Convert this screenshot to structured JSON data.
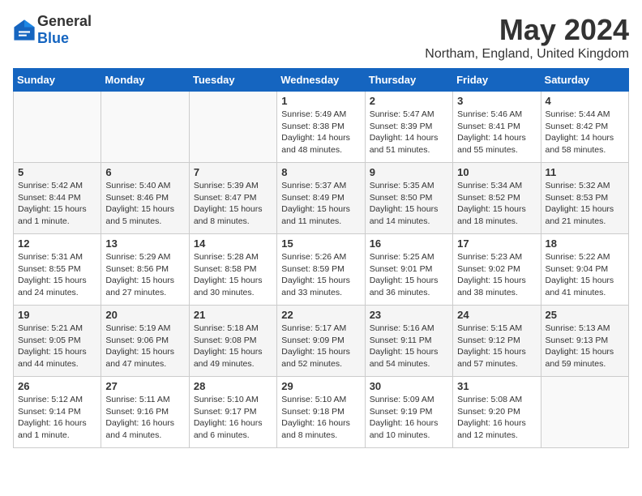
{
  "header": {
    "logo_general": "General",
    "logo_blue": "Blue",
    "month_year": "May 2024",
    "location": "Northam, England, United Kingdom"
  },
  "days_of_week": [
    "Sunday",
    "Monday",
    "Tuesday",
    "Wednesday",
    "Thursday",
    "Friday",
    "Saturday"
  ],
  "weeks": [
    [
      {
        "day": null,
        "info": null
      },
      {
        "day": null,
        "info": null
      },
      {
        "day": null,
        "info": null
      },
      {
        "day": "1",
        "info": "Sunrise: 5:49 AM\nSunset: 8:38 PM\nDaylight: 14 hours\nand 48 minutes."
      },
      {
        "day": "2",
        "info": "Sunrise: 5:47 AM\nSunset: 8:39 PM\nDaylight: 14 hours\nand 51 minutes."
      },
      {
        "day": "3",
        "info": "Sunrise: 5:46 AM\nSunset: 8:41 PM\nDaylight: 14 hours\nand 55 minutes."
      },
      {
        "day": "4",
        "info": "Sunrise: 5:44 AM\nSunset: 8:42 PM\nDaylight: 14 hours\nand 58 minutes."
      }
    ],
    [
      {
        "day": "5",
        "info": "Sunrise: 5:42 AM\nSunset: 8:44 PM\nDaylight: 15 hours\nand 1 minute."
      },
      {
        "day": "6",
        "info": "Sunrise: 5:40 AM\nSunset: 8:46 PM\nDaylight: 15 hours\nand 5 minutes."
      },
      {
        "day": "7",
        "info": "Sunrise: 5:39 AM\nSunset: 8:47 PM\nDaylight: 15 hours\nand 8 minutes."
      },
      {
        "day": "8",
        "info": "Sunrise: 5:37 AM\nSunset: 8:49 PM\nDaylight: 15 hours\nand 11 minutes."
      },
      {
        "day": "9",
        "info": "Sunrise: 5:35 AM\nSunset: 8:50 PM\nDaylight: 15 hours\nand 14 minutes."
      },
      {
        "day": "10",
        "info": "Sunrise: 5:34 AM\nSunset: 8:52 PM\nDaylight: 15 hours\nand 18 minutes."
      },
      {
        "day": "11",
        "info": "Sunrise: 5:32 AM\nSunset: 8:53 PM\nDaylight: 15 hours\nand 21 minutes."
      }
    ],
    [
      {
        "day": "12",
        "info": "Sunrise: 5:31 AM\nSunset: 8:55 PM\nDaylight: 15 hours\nand 24 minutes."
      },
      {
        "day": "13",
        "info": "Sunrise: 5:29 AM\nSunset: 8:56 PM\nDaylight: 15 hours\nand 27 minutes."
      },
      {
        "day": "14",
        "info": "Sunrise: 5:28 AM\nSunset: 8:58 PM\nDaylight: 15 hours\nand 30 minutes."
      },
      {
        "day": "15",
        "info": "Sunrise: 5:26 AM\nSunset: 8:59 PM\nDaylight: 15 hours\nand 33 minutes."
      },
      {
        "day": "16",
        "info": "Sunrise: 5:25 AM\nSunset: 9:01 PM\nDaylight: 15 hours\nand 36 minutes."
      },
      {
        "day": "17",
        "info": "Sunrise: 5:23 AM\nSunset: 9:02 PM\nDaylight: 15 hours\nand 38 minutes."
      },
      {
        "day": "18",
        "info": "Sunrise: 5:22 AM\nSunset: 9:04 PM\nDaylight: 15 hours\nand 41 minutes."
      }
    ],
    [
      {
        "day": "19",
        "info": "Sunrise: 5:21 AM\nSunset: 9:05 PM\nDaylight: 15 hours\nand 44 minutes."
      },
      {
        "day": "20",
        "info": "Sunrise: 5:19 AM\nSunset: 9:06 PM\nDaylight: 15 hours\nand 47 minutes."
      },
      {
        "day": "21",
        "info": "Sunrise: 5:18 AM\nSunset: 9:08 PM\nDaylight: 15 hours\nand 49 minutes."
      },
      {
        "day": "22",
        "info": "Sunrise: 5:17 AM\nSunset: 9:09 PM\nDaylight: 15 hours\nand 52 minutes."
      },
      {
        "day": "23",
        "info": "Sunrise: 5:16 AM\nSunset: 9:11 PM\nDaylight: 15 hours\nand 54 minutes."
      },
      {
        "day": "24",
        "info": "Sunrise: 5:15 AM\nSunset: 9:12 PM\nDaylight: 15 hours\nand 57 minutes."
      },
      {
        "day": "25",
        "info": "Sunrise: 5:13 AM\nSunset: 9:13 PM\nDaylight: 15 hours\nand 59 minutes."
      }
    ],
    [
      {
        "day": "26",
        "info": "Sunrise: 5:12 AM\nSunset: 9:14 PM\nDaylight: 16 hours\nand 1 minute."
      },
      {
        "day": "27",
        "info": "Sunrise: 5:11 AM\nSunset: 9:16 PM\nDaylight: 16 hours\nand 4 minutes."
      },
      {
        "day": "28",
        "info": "Sunrise: 5:10 AM\nSunset: 9:17 PM\nDaylight: 16 hours\nand 6 minutes."
      },
      {
        "day": "29",
        "info": "Sunrise: 5:10 AM\nSunset: 9:18 PM\nDaylight: 16 hours\nand 8 minutes."
      },
      {
        "day": "30",
        "info": "Sunrise: 5:09 AM\nSunset: 9:19 PM\nDaylight: 16 hours\nand 10 minutes."
      },
      {
        "day": "31",
        "info": "Sunrise: 5:08 AM\nSunset: 9:20 PM\nDaylight: 16 hours\nand 12 minutes."
      },
      {
        "day": null,
        "info": null
      }
    ]
  ]
}
